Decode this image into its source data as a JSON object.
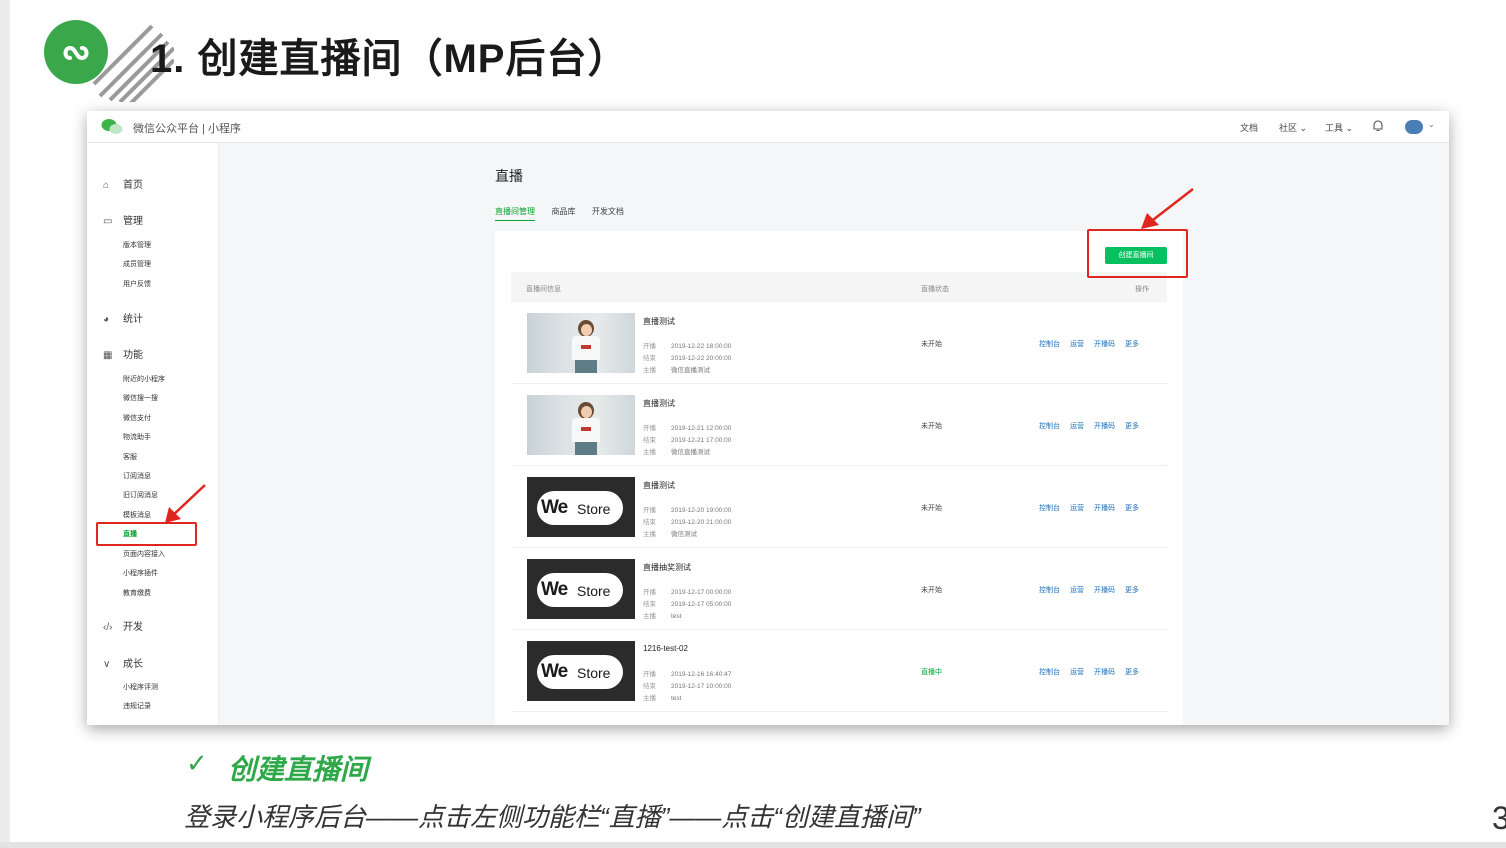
{
  "slide": {
    "title": "1. 创建直播间（MP后台）",
    "caption_title": "创建直播间",
    "caption_text": "登录小程序后台——点击左侧功能栏“直播”——点击“创建直播间”",
    "page_number": "3",
    "accent_color": "#2fa84a"
  },
  "app": {
    "brand": "微信公众平台 | 小程序",
    "top_nav": {
      "docs": "文档",
      "community": "社区",
      "tools": "工具"
    },
    "sidebar": {
      "home": "首页",
      "manage": "管理",
      "manage_items": [
        "版本管理",
        "成员管理",
        "用户反馈"
      ],
      "stats": "统计",
      "features": "功能",
      "feature_items": [
        "附近的小程序",
        "微信搜一搜",
        "微信支付",
        "物流助手",
        "客服",
        "订阅消息",
        "旧订阅消息",
        "模板消息",
        "直播",
        "页面内容接入",
        "小程序插件",
        "教育缴费"
      ],
      "develop": "开发",
      "growth": "成长",
      "growth_items": [
        "小程序评测",
        "违规记录"
      ]
    },
    "page": {
      "heading": "直播",
      "tabs": [
        "直播间管理",
        "商品库",
        "开发文档"
      ],
      "create_button": "创建直播间",
      "columns": {
        "info": "直播间信息",
        "status": "直播状态",
        "actions": "操作"
      },
      "meta_labels": {
        "start": "开播",
        "end": "结束",
        "host": "主播"
      },
      "row_actions": [
        "控制台",
        "运营",
        "开播码",
        "更多"
      ],
      "rooms": [
        {
          "title": "直播测试",
          "start": "2019-12-22 18:00:00",
          "end": "2019-12-22 20:00:00",
          "host": "微信直播测试",
          "status": "未开始",
          "thumb": "photo"
        },
        {
          "title": "直播测试",
          "start": "2019-12-21 12:00:00",
          "end": "2019-12-21 17:00:00",
          "host": "微信直播测试",
          "status": "未开始",
          "thumb": "photo"
        },
        {
          "title": "直播测试",
          "start": "2019-12-20 19:00:00",
          "end": "2019-12-20 21:00:00",
          "host": "微信测试",
          "status": "未开始",
          "thumb": "westore"
        },
        {
          "title": "直播抽奖测试",
          "start": "2019-12-17 00:00:00",
          "end": "2019-12-17 05:00:00",
          "host": "test",
          "status": "未开始",
          "thumb": "westore"
        },
        {
          "title": "1216-test-02",
          "start": "2019-12-16 16:40:47",
          "end": "2019-12-17 10:00:00",
          "host": "test",
          "status": "直播中",
          "thumb": "westore"
        }
      ],
      "thumb_logo": {
        "we": "We",
        "store": "Store"
      }
    },
    "colors": {
      "primary_green": "#07c160",
      "link_blue": "#1d6fb8",
      "highlight_red": "#e0271f"
    }
  }
}
